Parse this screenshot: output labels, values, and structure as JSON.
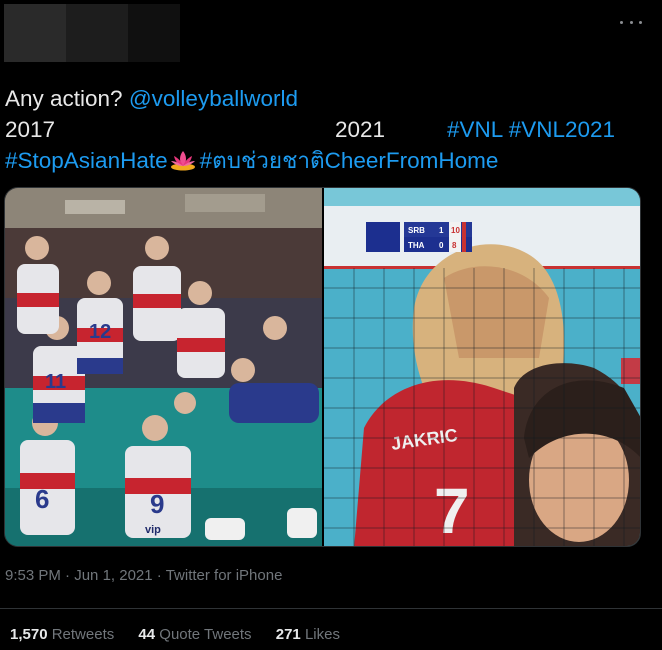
{
  "tweet": {
    "line1_text": "Any action? ",
    "mention": "@volleyballworld",
    "year_left": "2017",
    "year_right": "2021",
    "hashtags_line2": "#VNL #VNL2021",
    "hashtag_stop": "#StopAsianHate",
    "hashtag_cheer": "#ตบช่วยชาติCheerFromHome"
  },
  "media": {
    "scoreboard": {
      "team1": "SRB",
      "team1_set": "1",
      "team1_points": "10",
      "team2": "THA",
      "team2_set": "0",
      "team2_points": "8"
    },
    "jersey_name": "JAKRIC",
    "jersey_number": "7",
    "jersey_numbers_left": [
      "12",
      "11",
      "6",
      "9"
    ],
    "sponsor": "vip"
  },
  "meta": {
    "time": "9:53 PM",
    "separator": "·",
    "date": "Jun 1, 2021",
    "source": "Twitter for iPhone"
  },
  "stats": {
    "retweets_count": "1,570",
    "retweets_label": "Retweets",
    "quotes_count": "44",
    "quotes_label": "Quote Tweets",
    "likes_count": "271",
    "likes_label": "Likes"
  },
  "colors": {
    "background": "#000000",
    "link": "#1d9bf0",
    "text": "#e8e8e8",
    "muted": "#71767b"
  }
}
